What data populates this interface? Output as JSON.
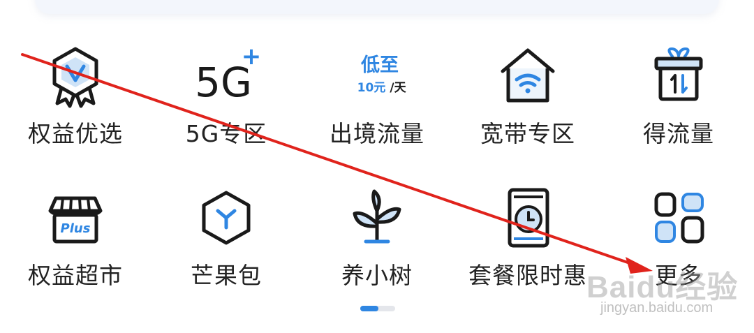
{
  "grid": {
    "row1": [
      {
        "label": "权益优选",
        "icon": "badge-v-icon"
      },
      {
        "label": "5G专区",
        "icon": "5g-plus-icon",
        "icon_text": "5G",
        "icon_plus": "+"
      },
      {
        "label": "出境流量",
        "icon": "promo-price-icon",
        "promo_line1": "低至",
        "promo_price": "10元",
        "promo_unit": "/天"
      },
      {
        "label": "宽带专区",
        "icon": "house-wifi-icon"
      },
      {
        "label": "得流量",
        "icon": "gift-box-icon"
      }
    ],
    "row2": [
      {
        "label": "权益超市",
        "icon": "plus-store-icon",
        "icon_text": "Plus"
      },
      {
        "label": "芒果包",
        "icon": "hexagon-y-icon"
      },
      {
        "label": "养小树",
        "icon": "sprout-icon"
      },
      {
        "label": "套餐限时惠",
        "icon": "package-clock-icon"
      },
      {
        "label": "更多",
        "icon": "more-grid-icon"
      }
    ]
  },
  "pager": {
    "pages": 2,
    "current": 1
  },
  "watermark": {
    "brand": "Baidu经验",
    "url": "jingyan.baidu.com"
  },
  "colors": {
    "accent": "#2f86e2",
    "icon_stroke": "#1a1a1a",
    "light_blue": "#cfe3f7",
    "arrow": "#e0231c",
    "label": "#222222"
  }
}
